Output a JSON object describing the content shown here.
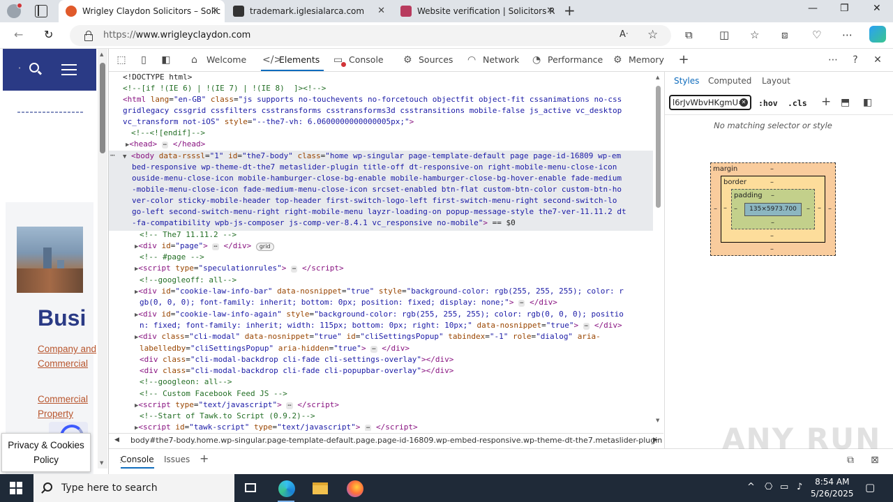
{
  "browser": {
    "tabs": [
      {
        "title": "Wrigley Claydon Solicitors – Solic",
        "active": true
      },
      {
        "title": "trademark.iglesialarca.com",
        "active": false
      },
      {
        "title": "Website verification | Solicitors R",
        "active": false
      }
    ],
    "url_scheme": "https://",
    "url_domain": "www.wrigleyclaydon.com"
  },
  "page": {
    "heading": "Busi",
    "links": [
      "Company and Commercial",
      "Commercial Property"
    ],
    "cookie_button": "Privacy & Cookies Policy"
  },
  "devtools": {
    "tabs": [
      "Welcome",
      "Elements",
      "Console",
      "Sources",
      "Network",
      "Performance",
      "Memory"
    ],
    "active_tab": "Elements",
    "styles_tabs": [
      "Styles",
      "Computed",
      "Layout"
    ],
    "filter_value": "l6rJvWbvHKgmU=",
    "hov": ":hov",
    "cls": ".cls",
    "no_match": "No matching selector or style",
    "box_model": {
      "margin": "margin",
      "border": "border",
      "padding": "padding",
      "content": "135×5973.700",
      "dash": "–"
    },
    "breadcrumb": "body#the7-body.home.wp-singular.page-template-default.page.page-id-16809.wp-embed-responsive.wp-theme-dt-the7.metaslider-plugin",
    "drawer_tabs": [
      "Console",
      "Issues"
    ]
  },
  "taskbar": {
    "search_placeholder": "Type here to search",
    "time": "8:54 AM",
    "date": "5/26/2025"
  },
  "watermark": "ANY RUN"
}
